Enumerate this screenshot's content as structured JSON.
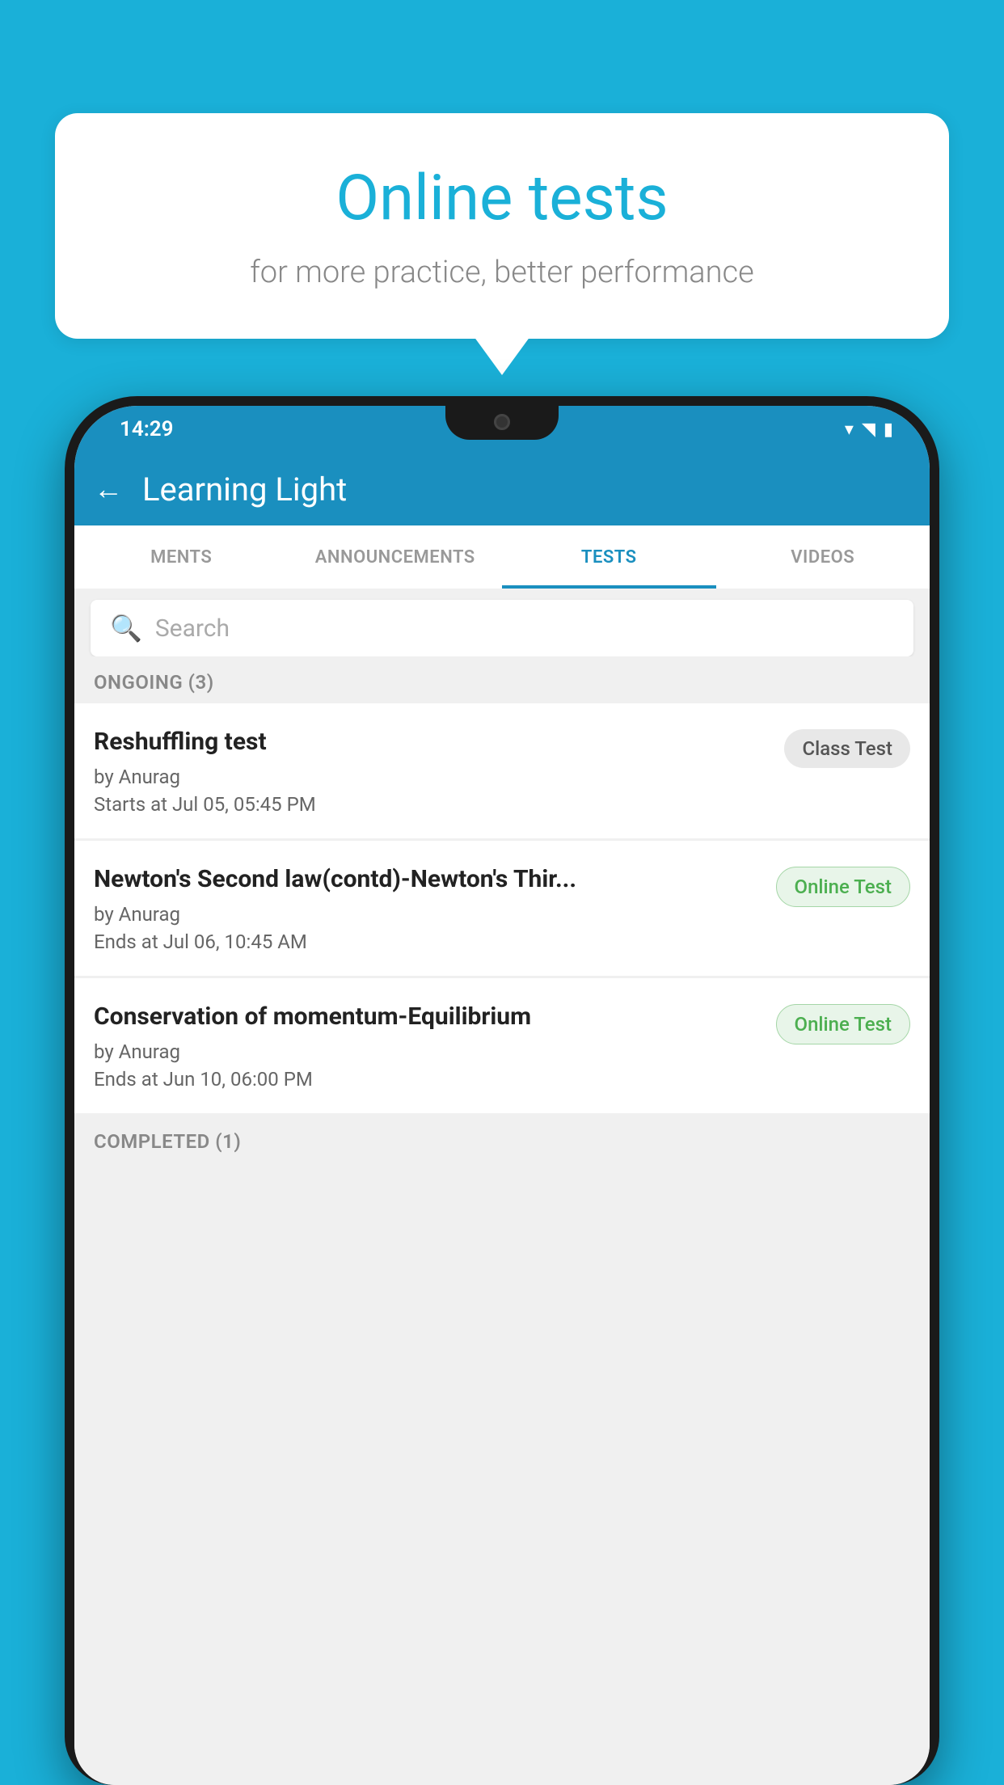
{
  "background_color": "#1ab0d8",
  "bubble": {
    "title": "Online tests",
    "subtitle": "for more practice, better performance"
  },
  "status_bar": {
    "time": "14:29",
    "icons": [
      "wifi",
      "signal",
      "battery"
    ]
  },
  "app_bar": {
    "title": "Learning Light",
    "back_label": "←"
  },
  "tabs": [
    {
      "label": "MENTS",
      "active": false
    },
    {
      "label": "ANNOUNCEMENTS",
      "active": false
    },
    {
      "label": "TESTS",
      "active": true
    },
    {
      "label": "VIDEOS",
      "active": false
    }
  ],
  "search": {
    "placeholder": "Search"
  },
  "sections": [
    {
      "header": "ONGOING (3)",
      "tests": [
        {
          "name": "Reshuffling test",
          "author": "by Anurag",
          "time_label": "Starts at",
          "time_value": "Jul 05, 05:45 PM",
          "badge": "Class Test",
          "badge_type": "class"
        },
        {
          "name": "Newton's Second law(contd)-Newton's Thir...",
          "author": "by Anurag",
          "time_label": "Ends at",
          "time_value": "Jul 06, 10:45 AM",
          "badge": "Online Test",
          "badge_type": "online"
        },
        {
          "name": "Conservation of momentum-Equilibrium",
          "author": "by Anurag",
          "time_label": "Ends at",
          "time_value": "Jun 10, 06:00 PM",
          "badge": "Online Test",
          "badge_type": "online"
        }
      ]
    },
    {
      "header": "COMPLETED (1)",
      "tests": []
    }
  ]
}
